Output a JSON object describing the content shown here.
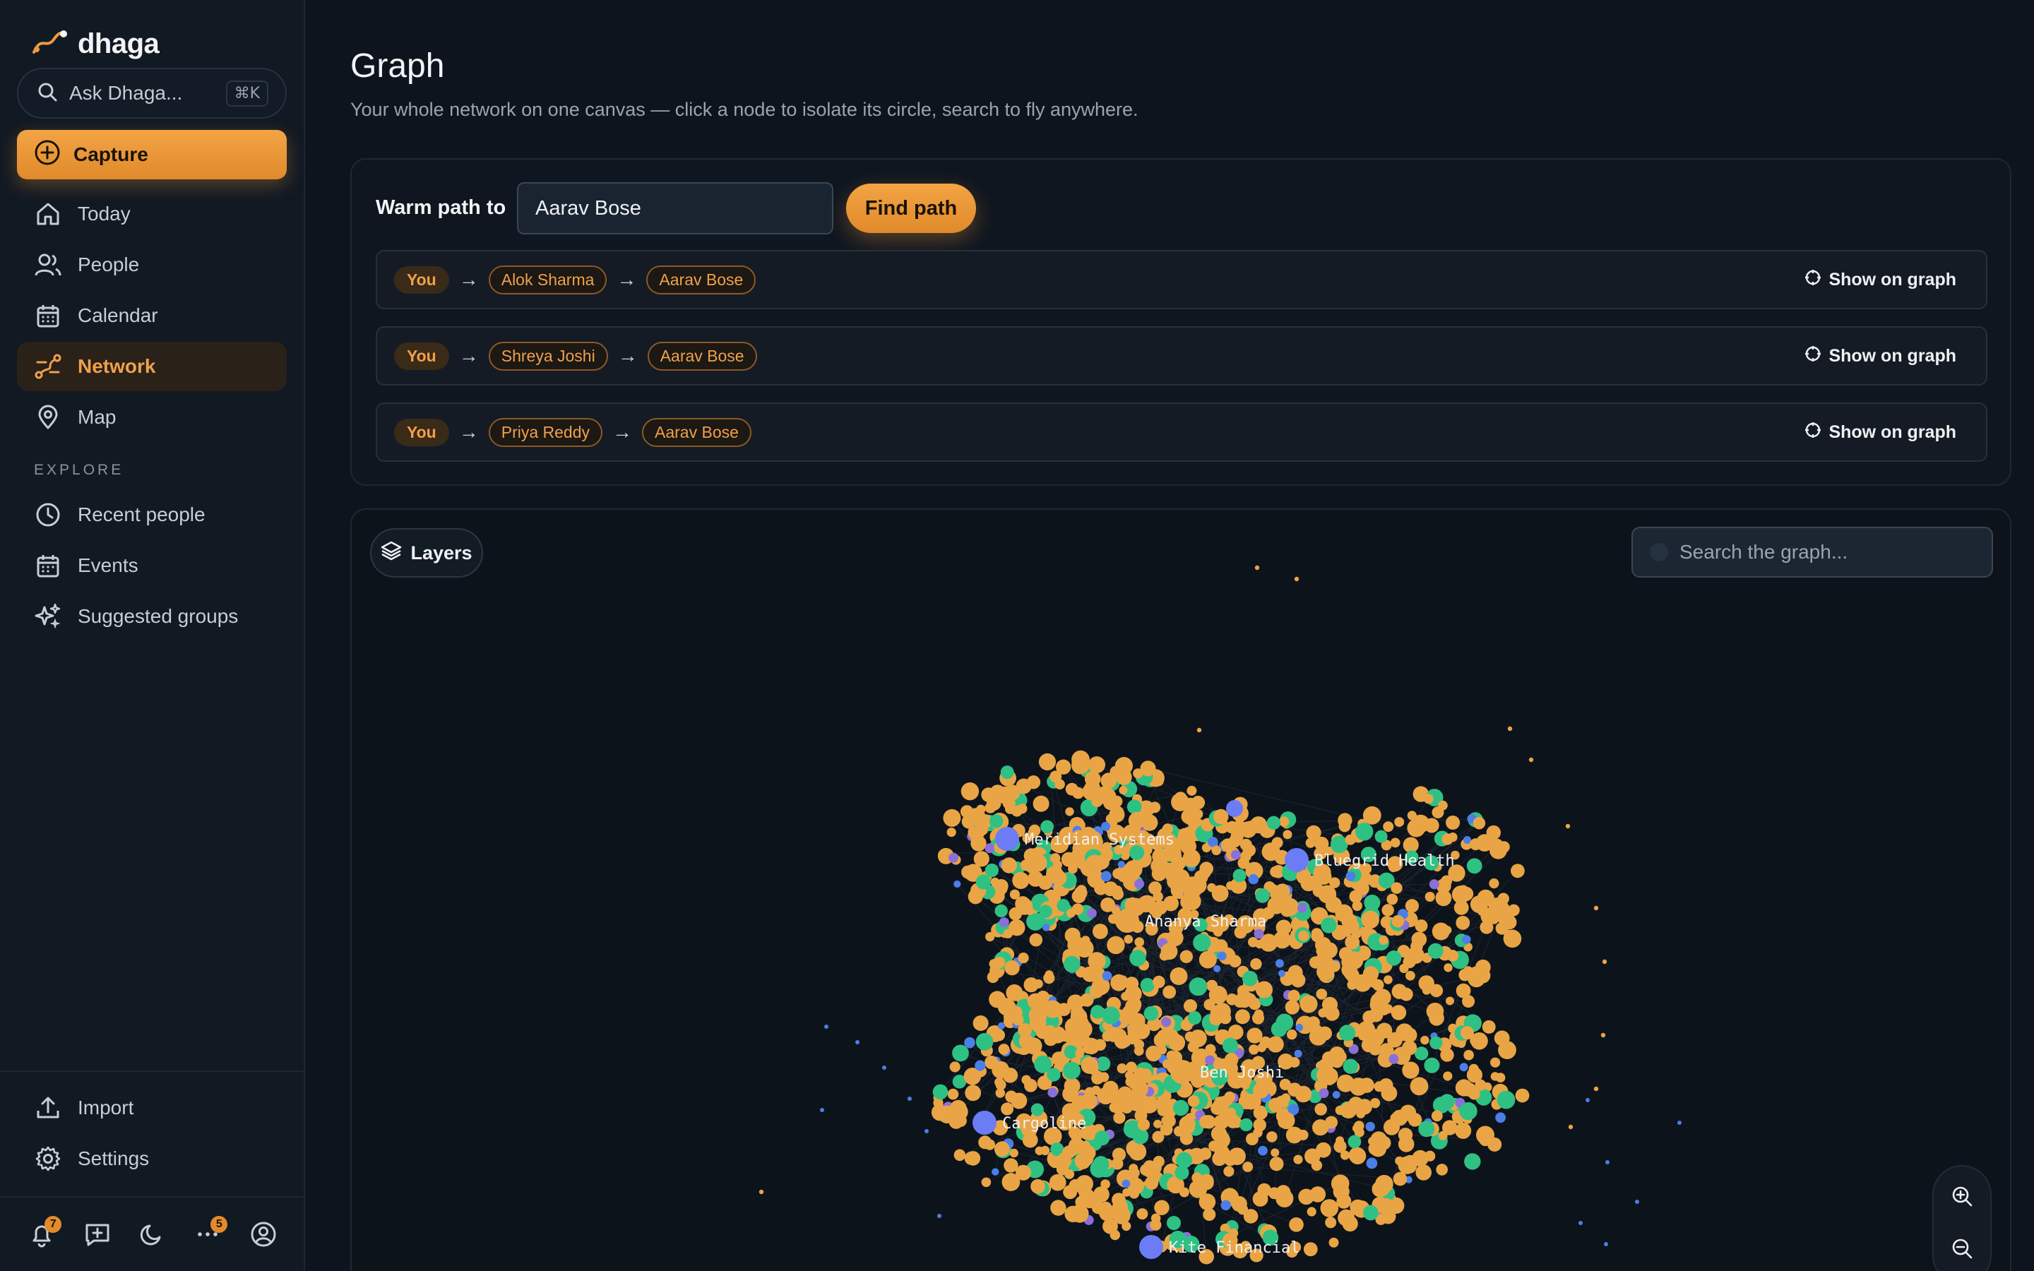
{
  "app": {
    "brand": "dhaga",
    "ask_placeholder": "Ask Dhaga...",
    "ask_shortcut": "⌘K",
    "capture_label": "Capture"
  },
  "sidebar": {
    "nav": [
      {
        "label": "Today",
        "icon": "home-icon"
      },
      {
        "label": "People",
        "icon": "people-icon"
      },
      {
        "label": "Calendar",
        "icon": "calendar-icon"
      },
      {
        "label": "Network",
        "icon": "network-icon",
        "active": true
      },
      {
        "label": "Map",
        "icon": "map-pin-icon"
      }
    ],
    "explore_label": "EXPLORE",
    "explore": [
      {
        "label": "Recent people",
        "icon": "clock-icon"
      },
      {
        "label": "Events",
        "icon": "calendar-icon"
      },
      {
        "label": "Suggested groups",
        "icon": "sparkle-icon"
      }
    ],
    "footer": [
      {
        "label": "Import",
        "icon": "upload-icon"
      },
      {
        "label": "Settings",
        "icon": "gear-icon"
      }
    ],
    "bottom_bar": {
      "notifications_count": "7",
      "more_count": "5"
    }
  },
  "page": {
    "title": "Graph",
    "subtitle": "Your whole network on one canvas — click a node to isolate its circle, search to fly anywhere."
  },
  "warm_path": {
    "label": "Warm path to",
    "input_value": "Aarav Bose",
    "button_label": "Find path",
    "show_label": "Show on graph",
    "paths": [
      {
        "start": "You",
        "via": "Alok Sharma",
        "target": "Aarav Bose"
      },
      {
        "start": "You",
        "via": "Shreya Joshi",
        "target": "Aarav Bose"
      },
      {
        "start": "You",
        "via": "Priya Reddy",
        "target": "Aarav Bose"
      }
    ]
  },
  "graph": {
    "layers_label": "Layers",
    "search_placeholder": "Search the graph...",
    "labels": [
      "Meridian Systems",
      "Bluegrid Health",
      "Ananya Sharma",
      "Ben Joshi",
      "Cargoline",
      "Kite Financial"
    ],
    "colors": {
      "person": "#e9a545",
      "company": "#6b7cf5",
      "group": "#2fc184",
      "tag": "#8b6fd8",
      "small": "#4c7ee8"
    }
  }
}
